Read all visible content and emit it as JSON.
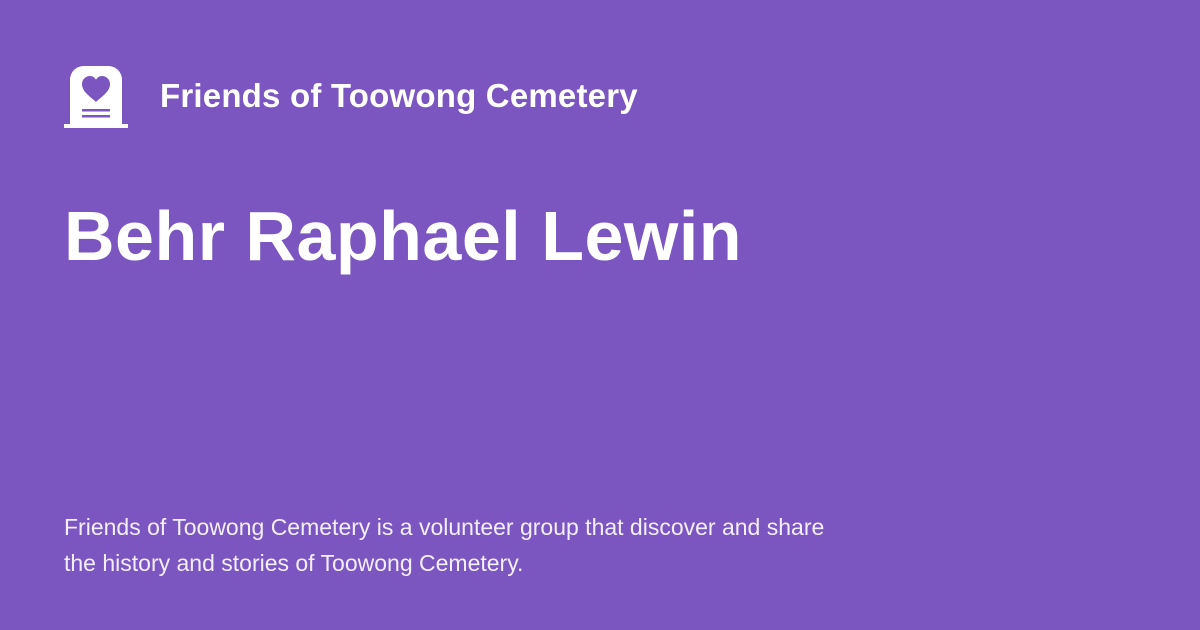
{
  "brand": {
    "logo_icon": "headstone-heart-icon",
    "name": "Friends of Toowong Cemetery"
  },
  "page": {
    "title": "Behr Raphael Lewin",
    "description": "Friends of Toowong Cemetery is a volunteer group that discover and share the history and stories of Toowong Cemetery."
  },
  "colors": {
    "background": "#7b55c0",
    "text": "#ffffff"
  }
}
